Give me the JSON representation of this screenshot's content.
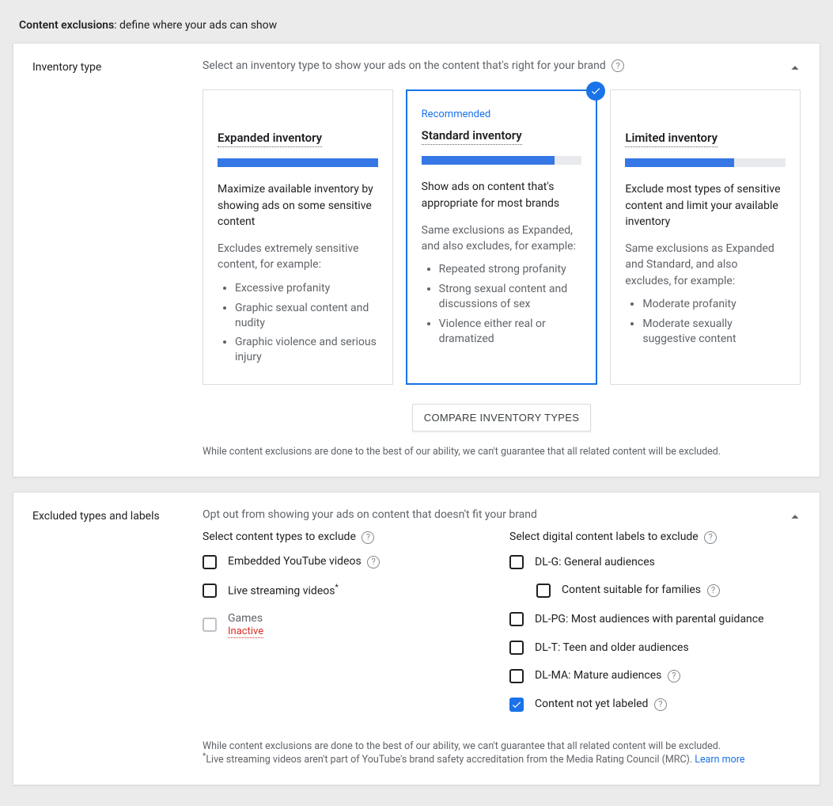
{
  "header": {
    "title_bold": "Content exclusions",
    "title_rest": ": define where your ads can show"
  },
  "inventory": {
    "label": "Inventory type",
    "desc": "Select an inventory type to show your ads on the content that's right for your brand",
    "recommended_label": "Recommended",
    "cards": [
      {
        "title": "Expanded inventory",
        "fill_pct": 100,
        "body": "Maximize available inventory by showing ads on some sensitive content",
        "sub": "Excludes extremely sensitive content, for example:",
        "bullets": [
          "Excessive profanity",
          "Graphic sexual content and nudity",
          "Graphic violence and serious injury"
        ]
      },
      {
        "title": "Standard inventory",
        "fill_pct": 83,
        "body": "Show ads on content that's appropriate for most brands",
        "sub": "Same exclusions as Expanded, and also excludes, for example:",
        "bullets": [
          "Repeated strong profanity",
          "Strong sexual content and discussions of sex",
          "Violence either real or dramatized"
        ]
      },
      {
        "title": "Limited inventory",
        "fill_pct": 68,
        "body": "Exclude most types of sensitive content and limit your available inventory",
        "sub": "Same exclusions as Expanded and Standard, and also excludes, for example:",
        "bullets": [
          "Moderate profanity",
          "Moderate sexually suggestive content"
        ]
      }
    ],
    "selected_index": 1,
    "compare_button": "COMPARE INVENTORY TYPES",
    "disclaimer": "While content exclusions are done to the best of our ability, we can't guarantee that all related content will be excluded."
  },
  "excluded": {
    "label": "Excluded types and labels",
    "desc": "Opt out from showing your ads on content that doesn't fit your brand",
    "types_heading": "Select content types to exclude",
    "labels_heading": "Select digital content labels to exclude",
    "types": [
      {
        "label": "Embedded YouTube videos",
        "checked": false,
        "disabled": false,
        "help": true
      },
      {
        "label": "Live streaming videos",
        "checked": false,
        "disabled": false,
        "asterisk": true
      },
      {
        "label": "Games",
        "checked": false,
        "disabled": true,
        "sublabel": "Inactive"
      }
    ],
    "labels": [
      {
        "label": "DL-G: General audiences",
        "checked": false,
        "indent": false
      },
      {
        "label": "Content suitable for families",
        "checked": false,
        "indent": true,
        "help": true
      },
      {
        "label": "DL-PG: Most audiences with parental guidance",
        "checked": false,
        "indent": false
      },
      {
        "label": "DL-T: Teen and older audiences",
        "checked": false,
        "indent": false
      },
      {
        "label": "DL-MA: Mature audiences",
        "checked": false,
        "indent": false,
        "help": true
      },
      {
        "label": "Content not yet labeled",
        "checked": true,
        "indent": false,
        "help": true
      }
    ],
    "disclaimer1": "While content exclusions are done to the best of our ability, we can't guarantee that all related content will be excluded.",
    "disclaimer2": "Live streaming videos aren't part of YouTube's brand safety accreditation from the Media Rating Council (MRC). ",
    "learn_more": "Learn more"
  }
}
